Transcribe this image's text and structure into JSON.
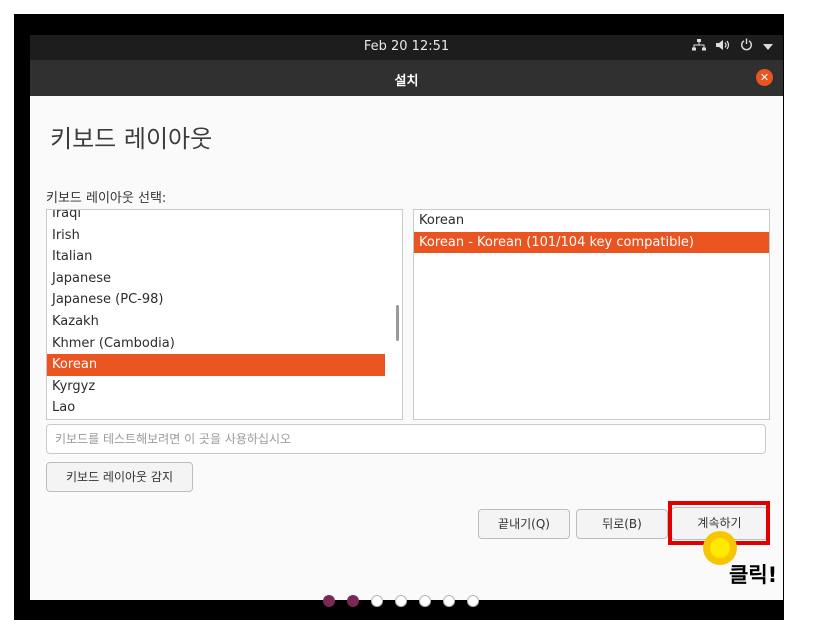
{
  "topbar": {
    "datetime": "Feb 20  12:51"
  },
  "icons": {
    "network": "network-icon",
    "volume": "volume-icon",
    "power": "power-icon",
    "menu": "chevron-down-icon"
  },
  "window": {
    "title": "설치",
    "close_glyph": "✕"
  },
  "page": {
    "heading": "키보드 레이아웃",
    "layout_select_label": "키보드 레이아웃 선택:"
  },
  "layouts": [
    {
      "label": "Iraqi",
      "selected": false
    },
    {
      "label": "Irish",
      "selected": false
    },
    {
      "label": "Italian",
      "selected": false
    },
    {
      "label": "Japanese",
      "selected": false
    },
    {
      "label": "Japanese (PC-98)",
      "selected": false
    },
    {
      "label": "Kazakh",
      "selected": false
    },
    {
      "label": "Khmer (Cambodia)",
      "selected": false
    },
    {
      "label": "Korean",
      "selected": true
    },
    {
      "label": "Kyrgyz",
      "selected": false
    },
    {
      "label": "Lao",
      "selected": false
    }
  ],
  "variants": [
    {
      "label": "Korean",
      "selected": false
    },
    {
      "label": "Korean - Korean (101/104 key compatible)",
      "selected": true
    }
  ],
  "test_input": {
    "placeholder": "키보드를 테스트해보려면 이 곳을 사용하십시오",
    "value": ""
  },
  "buttons": {
    "detect": "키보드 레이아웃 감지",
    "quit": "끝내기(Q)",
    "back": "뒤로(B)",
    "continue": "계속하기"
  },
  "annotation": {
    "click_label": "클릭!",
    "highlight_color": "#e00000",
    "cursor_color": "#ffe900"
  },
  "progress": {
    "total_steps": 7,
    "current_step": 2
  },
  "colors": {
    "accent": "#e95420",
    "titlebar": "#303030",
    "topbar": "#1d1d1d"
  }
}
